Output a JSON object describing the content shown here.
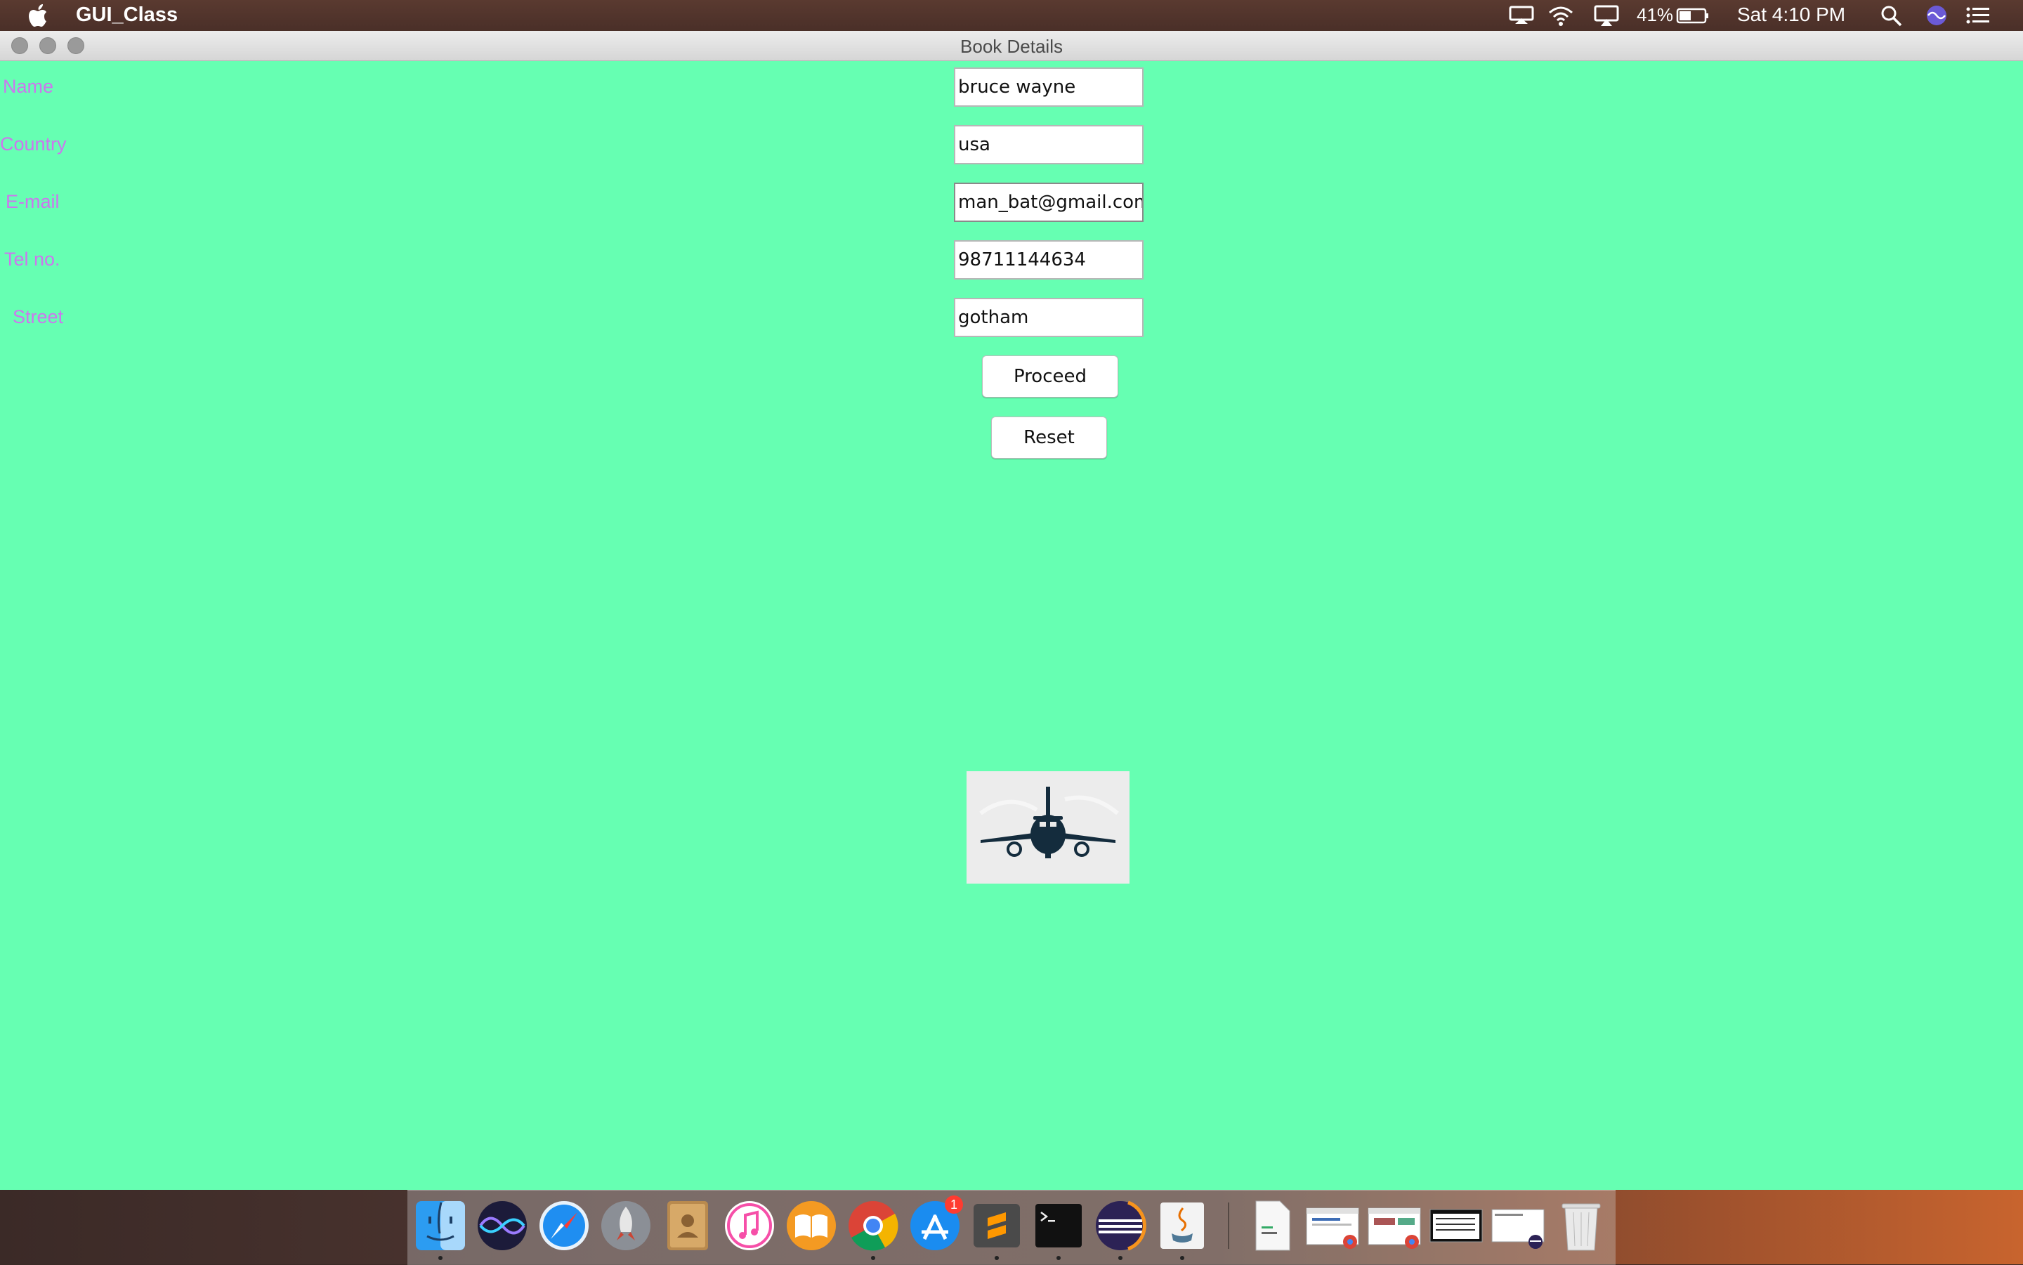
{
  "menubar": {
    "app_name": "GUI_Class",
    "battery_percent": "41%",
    "clock": "Sat 4:10 PM",
    "icons": [
      "apple-icon",
      "display-icon",
      "wifi-icon",
      "airplay-icon",
      "battery-icon",
      "search-icon",
      "siri-icon",
      "notification-center-icon"
    ]
  },
  "window": {
    "title": "Book Details",
    "background": "#66ffb2"
  },
  "form": {
    "labels": {
      "name": "Name",
      "country": "Country",
      "email": "E-mail",
      "tel": "Tel no.",
      "street": "Street"
    },
    "values": {
      "name": "bruce wayne",
      "country": "usa",
      "email": "man_bat@gmail.com",
      "tel": "98711144634",
      "street": "gotham"
    },
    "label_color": "#cc77ee"
  },
  "buttons": {
    "proceed": "Proceed",
    "reset": "Reset"
  },
  "image": {
    "icon": "airplane-icon"
  },
  "dock": {
    "apps": [
      "finder-icon",
      "siri-icon",
      "safari-icon",
      "launchpad-icon",
      "contacts-icon",
      "itunes-icon",
      "ibooks-icon",
      "chrome-icon",
      "app-store-icon",
      "sublime-text-icon",
      "terminal-icon",
      "eclipse-icon",
      "java-icon",
      "document-c-icon",
      "chrome-window-thumbnail",
      "chrome-window-thumbnail",
      "window-thumbnail",
      "eclipse-window-thumbnail",
      "trash-icon"
    ],
    "app_store_badge": "1"
  }
}
